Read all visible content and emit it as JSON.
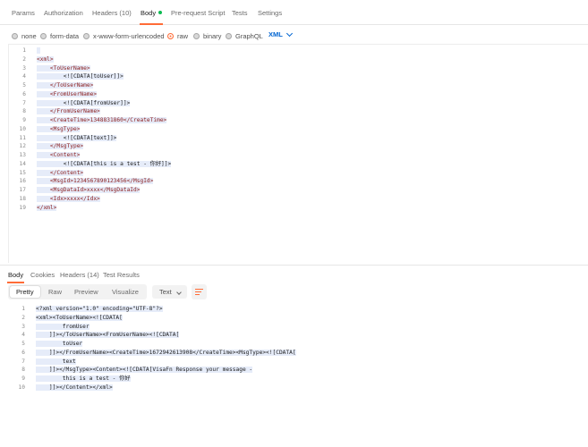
{
  "request_tabs": [
    {
      "label": "Params",
      "active": false
    },
    {
      "label": "Authorization",
      "active": false
    },
    {
      "label": "Headers (10)",
      "active": false
    },
    {
      "label": "Body",
      "active": true,
      "dot": true
    },
    {
      "label": "Pre-request Script",
      "active": false
    },
    {
      "label": "Tests",
      "active": false
    },
    {
      "label": "Settings",
      "active": false
    }
  ],
  "body_types": [
    {
      "label": "none",
      "checked": false
    },
    {
      "label": "form-data",
      "checked": false
    },
    {
      "label": "x-www-form-urlencoded",
      "checked": false
    },
    {
      "label": "raw",
      "checked": true
    },
    {
      "label": "binary",
      "checked": false
    },
    {
      "label": "GraphQL",
      "checked": false
    }
  ],
  "raw_language": "XML",
  "request_body": [
    "",
    "<xml>",
    "    <ToUserName>",
    "        <![CDATA[toUser]]>",
    "    </ToUserName>",
    "    <FromUserName>",
    "        <![CDATA[fromUser]]>",
    "    </FromUserName>",
    "    <CreateTime>1348831860</CreateTime>",
    "    <MsgType>",
    "        <![CDATA[text]]>",
    "    </MsgType>",
    "    <Content>",
    "        <![CDATA[this is a test - 你好]]>",
    "    </Content>",
    "    <MsgId>1234567890123456</MsgId>",
    "    <MsgDataId>xxxx</MsgDataId>",
    "    <Idx>xxxx</Idx>",
    "</xml>"
  ],
  "response_tabs": [
    {
      "label": "Body",
      "active": true
    },
    {
      "label": "Cookies",
      "active": false
    },
    {
      "label": "Headers (14)",
      "active": false
    },
    {
      "label": "Test Results",
      "active": false
    }
  ],
  "view_modes": [
    {
      "label": "Pretty",
      "active": true
    },
    {
      "label": "Raw",
      "active": false
    },
    {
      "label": "Preview",
      "active": false
    },
    {
      "label": "Visualize",
      "active": false
    }
  ],
  "response_format": "Text",
  "response_body": [
    {
      "n": "1",
      "text": "<?xml version=\"1.0\" encoding=\"UTF-8\"?>"
    },
    {
      "n": "2",
      "text": "<xml><ToUserName><![CDATA["
    },
    {
      "n": "3",
      "text": "        fromUser"
    },
    {
      "n": "4",
      "text": "    ]]></ToUserName><FromUserName><![CDATA["
    },
    {
      "n": "5",
      "text": "        toUser"
    },
    {
      "n": "6",
      "text": "    ]]></FromUserName><CreateTime>1672942613908</CreateTime><MsgType><![CDATA["
    },
    {
      "n": "7",
      "text": "        text"
    },
    {
      "n": "8",
      "text": "    ]]></MsgType><Content><![CDATA[VisaFn Response your message -"
    },
    {
      "n": "9",
      "text": "        this is a test - 你好"
    },
    {
      "n": "10",
      "text": "    ]]></Content></xml>"
    }
  ]
}
